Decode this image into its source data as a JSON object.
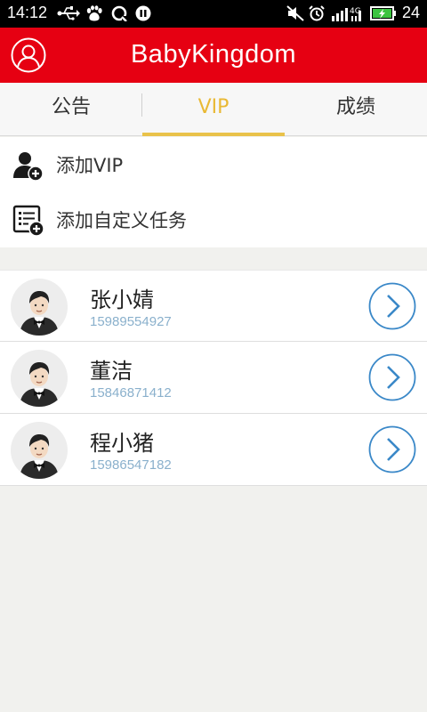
{
  "status_bar": {
    "time": "14:12",
    "battery": "24",
    "network": "4G",
    "icons": [
      "usb-icon",
      "baidu-paw-icon",
      "sync-icon",
      "pause-icon",
      "mute-icon",
      "alarm-icon",
      "signal-icon",
      "battery-icon"
    ]
  },
  "app_bar": {
    "title": "BabyKingdom",
    "background": "#e60012",
    "profile_icon": "user-circle-icon"
  },
  "tabs": [
    {
      "label": "公告",
      "active": false
    },
    {
      "label": "VIP",
      "active": true
    },
    {
      "label": "成绩",
      "active": false
    }
  ],
  "tab_active_color": "#e9b934",
  "actions": [
    {
      "label": "添加VIP",
      "icon": "add-user-icon"
    },
    {
      "label": "添加自定义任务",
      "icon": "add-task-icon"
    }
  ],
  "contacts": [
    {
      "name": "张小婧",
      "phone": "15989554927"
    },
    {
      "name": "董洁",
      "phone": "15846871412"
    },
    {
      "name": "程小猪",
      "phone": "15986547182"
    }
  ],
  "colors": {
    "phone": "#8ab0cc",
    "arrow": "#3a88c8"
  }
}
